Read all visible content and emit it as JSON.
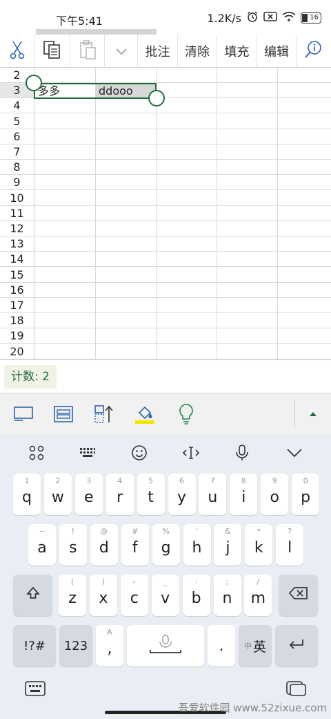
{
  "status": {
    "time": "下午5:41",
    "speed": "1.2K/s",
    "battery": "16"
  },
  "toolbar": {
    "comment": "批注",
    "clear": "清除",
    "fill": "填充",
    "edit": "编辑"
  },
  "grid": {
    "rows": [
      "2",
      "3",
      "4",
      "5",
      "6",
      "7",
      "8",
      "9",
      "10",
      "11",
      "12",
      "13",
      "14",
      "15",
      "16",
      "17",
      "18",
      "19",
      "20"
    ],
    "selected_row": "3",
    "cell_a3": "多多",
    "cell_b3": "ddooo"
  },
  "countbar": {
    "label": "计数: 2"
  },
  "keyboard": {
    "row1": [
      {
        "k": "q",
        "s": "1"
      },
      {
        "k": "w",
        "s": "2"
      },
      {
        "k": "e",
        "s": "3"
      },
      {
        "k": "r",
        "s": "4"
      },
      {
        "k": "t",
        "s": "5"
      },
      {
        "k": "y",
        "s": "6"
      },
      {
        "k": "u",
        "s": "7"
      },
      {
        "k": "i",
        "s": "8"
      },
      {
        "k": "o",
        "s": "9"
      },
      {
        "k": "p",
        "s": "0"
      }
    ],
    "row2": [
      {
        "k": "a",
        "s": "~"
      },
      {
        "k": "s",
        "s": "!"
      },
      {
        "k": "d",
        "s": "@"
      },
      {
        "k": "f",
        "s": "#"
      },
      {
        "k": "g",
        "s": "%"
      },
      {
        "k": "h",
        "s": "'"
      },
      {
        "k": "j",
        "s": "&"
      },
      {
        "k": "k",
        "s": "*"
      },
      {
        "k": "l",
        "s": "?"
      }
    ],
    "row3": [
      {
        "k": "z",
        "s": "("
      },
      {
        "k": "x",
        "s": ")"
      },
      {
        "k": "c",
        "s": "-"
      },
      {
        "k": "v",
        "s": "_"
      },
      {
        "k": "b",
        "s": ":"
      },
      {
        "k": "n",
        "s": ";"
      },
      {
        "k": "m",
        "s": "/"
      }
    ],
    "sym": "!?#",
    "num": "123",
    "comma": ",",
    "comma_sup": "A",
    "period": ".",
    "lang_small": "中",
    "lang_big": "英"
  },
  "watermark": "吾爱软件园 www.52zixue.com"
}
